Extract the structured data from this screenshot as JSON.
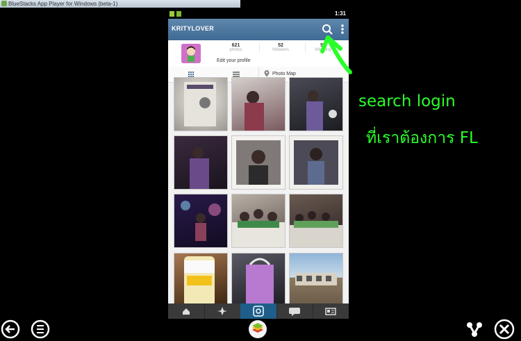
{
  "window": {
    "title": "BlueStacks App Player for Windows (beta-1)"
  },
  "status_bar": {
    "time": "1:31"
  },
  "app_bar": {
    "username": "KRITYLOVER",
    "search_icon": "search-icon",
    "menu_icon": "overflow-menu-icon"
  },
  "profile": {
    "stats": [
      {
        "value": "621",
        "label": "photos"
      },
      {
        "value": "52",
        "label": "followers"
      },
      {
        "value": "57",
        "label": "following"
      }
    ],
    "edit_label": "Edit your profile"
  },
  "view_tabs": {
    "grid_icon": "grid-icon",
    "list_icon": "list-icon",
    "map_icon": "pin-icon",
    "map_label": "Photo Map"
  },
  "bottom_nav": [
    "home-icon",
    "explore-icon",
    "camera-icon",
    "news-icon",
    "profile-icon"
  ],
  "annotation": {
    "line1": "search login",
    "line2": "ที่เราต้องการ FL",
    "color": "#29ff29"
  },
  "colors": {
    "app_bar": "#4f7aa0",
    "active_tab": "#1f5e8a"
  }
}
